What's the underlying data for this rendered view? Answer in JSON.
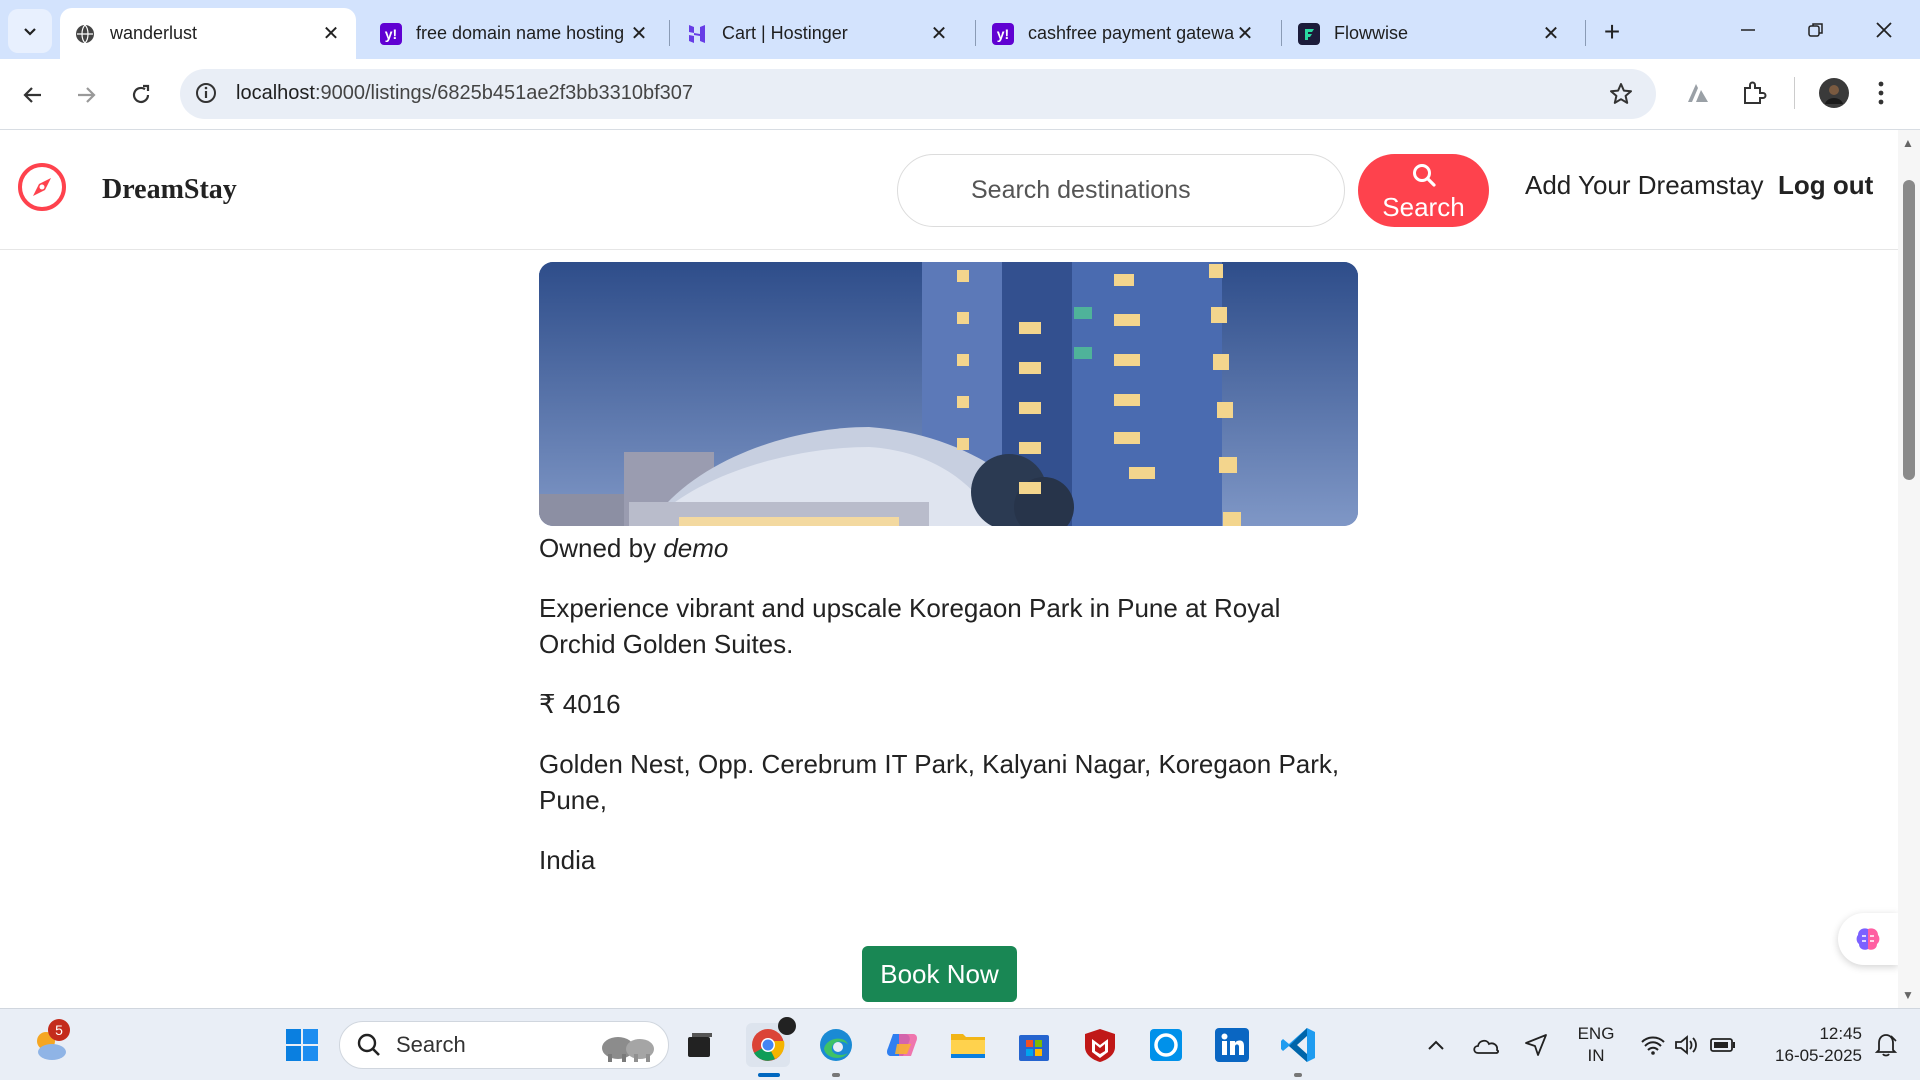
{
  "browser": {
    "tabs": [
      {
        "title": "wanderlust",
        "active": true,
        "favicon": "globe-icon"
      },
      {
        "title": "free domain name hosting",
        "active": false,
        "favicon": "yahoo-icon"
      },
      {
        "title": "Cart | Hostinger",
        "active": false,
        "favicon": "hostinger-icon"
      },
      {
        "title": "cashfree payment gateway",
        "active": false,
        "favicon": "yahoo-icon"
      },
      {
        "title": "Flowwise",
        "active": false,
        "favicon": "flowise-icon"
      }
    ],
    "url_host": "localhost",
    "url_rest": ":9000/listings/6825b451ae2f3bb3310bf307"
  },
  "site": {
    "brand": "DreamStay",
    "search_placeholder": "Search destinations",
    "search_button": "Search",
    "add_link": "Add Your Dreamstay",
    "logout_link": "Log out"
  },
  "listing": {
    "owned_prefix": "Owned by",
    "owner": "demo",
    "description": "Experience vibrant and upscale Koregaon Park in Pune at Royal Orchid Golden Suites.",
    "price": "₹ 4016",
    "location": "Golden Nest, Opp. Cerebrum IT Park, Kalyani Nagar, Koregaon Park, Pune,",
    "country": "India",
    "book_button": "Book Now"
  },
  "taskbar": {
    "weather_badge": "5",
    "search_label": "Search",
    "language": "ENG",
    "region": "IN",
    "time": "12:45",
    "date": "16-05-2025"
  },
  "colors": {
    "brand_red": "#fe424d",
    "book_green": "#198754",
    "tabbar": "#d3e3fd"
  }
}
